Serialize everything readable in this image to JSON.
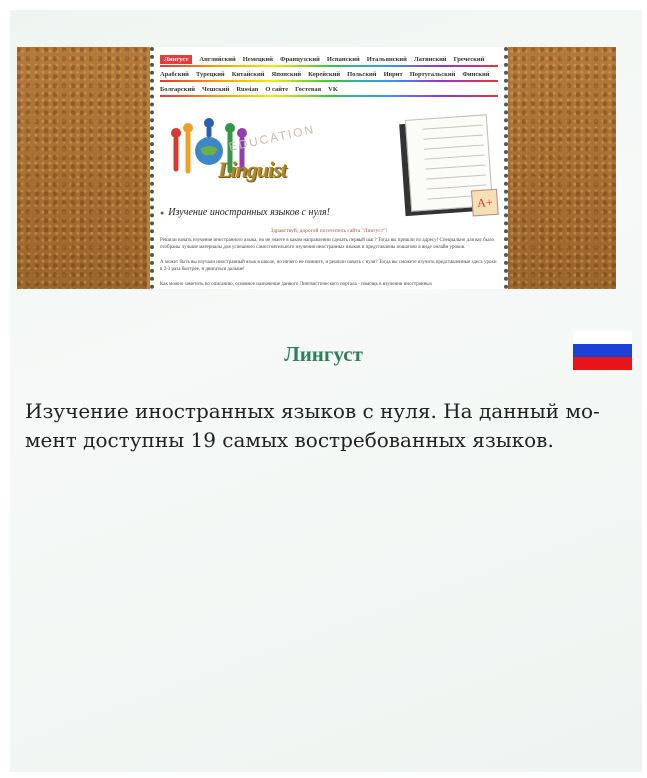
{
  "screenshot": {
    "menu_row1": [
      "Лингуст",
      "Английский",
      "Немецкий",
      "Французский",
      "Испанский",
      "Итальянский",
      "Латинский",
      "Греческий"
    ],
    "menu_row2": [
      "Арабский",
      "Турецкий",
      "Китайский",
      "Японский",
      "Корейский",
      "Польский",
      "Иврит",
      "Португальский",
      "Финский"
    ],
    "menu_row3": [
      "Болгарский",
      "Чешский",
      "Russian",
      "О сайте",
      "Гостевая",
      "VK"
    ],
    "logo_text": "Linguist",
    "education_text": "EDUCATION",
    "heading": "Изучение иностранных языков с нуля!",
    "greeting": "Здравствуй, дорогой посетитель сайта \"Лингуст\"!",
    "paragraph1": "Решили начать изучение иностранного языка, но не знаете в каком направлении сделать первый шаг? Тогда вы пришли по адресу! Специально для вас было отобраны лучшие материалы для успешного самостоятельного изучения иностранных языков и представлены пошагово в виде онлайн уроков.",
    "paragraph2": "А может быть вы изучали иностранный язык в школе, но ничего не помните, и решили начать с нуля? Тогда вы сможете изучить представленные здесь уроки в 2-3 раза быстрее, и двигаться дальше!",
    "paragraph3": "Как можно заметить по описанию, основное назначение данного Лингвистического портала - помощь в изучении иностранных"
  },
  "title": "Лингуст",
  "flag": {
    "name": "russia-flag-icon",
    "colors": [
      "#ffffff",
      "#1c3fd6",
      "#e8141c"
    ]
  },
  "description": "Изучение иностранных языков с нуля. На данный мо- мент доступны 19 самых востребованных языков."
}
